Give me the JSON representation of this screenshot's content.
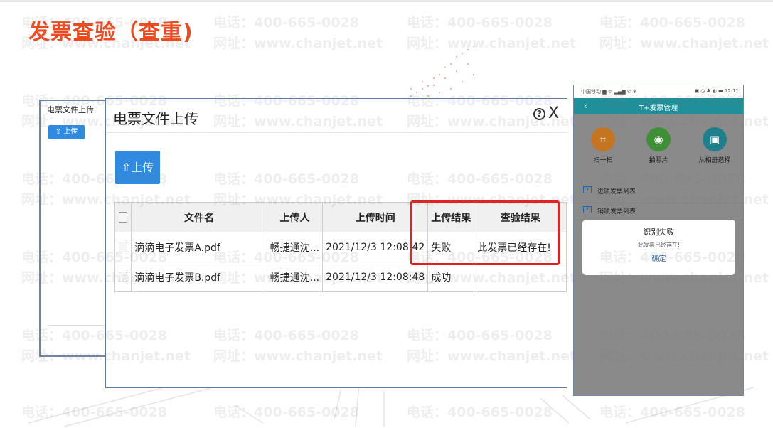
{
  "slide": {
    "title": "发票查验（查重)"
  },
  "watermark": {
    "phone": "电话：400-665-0028",
    "site": "网址：www.chanjet.net"
  },
  "back_panel": {
    "title": "电票文件上传",
    "upload_label": "上传"
  },
  "dialog": {
    "title": "电票文件上传",
    "help_glyph": "?",
    "close_glyph": "X",
    "upload_label": "上传",
    "table": {
      "headers": [
        "文件名",
        "上传人",
        "上传时间",
        "上传结果",
        "查验结果"
      ],
      "rows": [
        {
          "file": "滴滴电子发票A.pdf",
          "user": "畅捷通沈...",
          "time": "2021/12/3 12:08:42",
          "result": "失败",
          "check": "此发票已经存在!"
        },
        {
          "file": "滴滴电子发票B.pdf",
          "user": "畅捷通沈...",
          "time": "2021/12/3 12:08:48",
          "result": "成功",
          "check": ""
        }
      ]
    }
  },
  "phone": {
    "status_left": "中国移动 ▆ ᯤ ▂▄▆ ✆ ❄",
    "status_right": "▣ ◷ ✱ ◐ ▬ 12:11",
    "header_title": "T+发票管理",
    "actions": [
      {
        "label": "扫一扫",
        "icon": "scan-icon",
        "glyph": "⌗",
        "color": "#c5741f"
      },
      {
        "label": "拍照片",
        "icon": "camera-icon",
        "glyph": "◉",
        "color": "#3f8f37"
      },
      {
        "label": "从相册选择",
        "icon": "album-icon",
        "glyph": "▣",
        "color": "#1f7f8c"
      }
    ],
    "list": [
      {
        "label": "进项发票列表",
        "icon": "invoice-in-icon"
      },
      {
        "label": "销项发票列表",
        "icon": "invoice-out-icon"
      }
    ],
    "alert": {
      "title": "识别失败",
      "message": "此发票已经存在!",
      "button": "确定"
    }
  }
}
